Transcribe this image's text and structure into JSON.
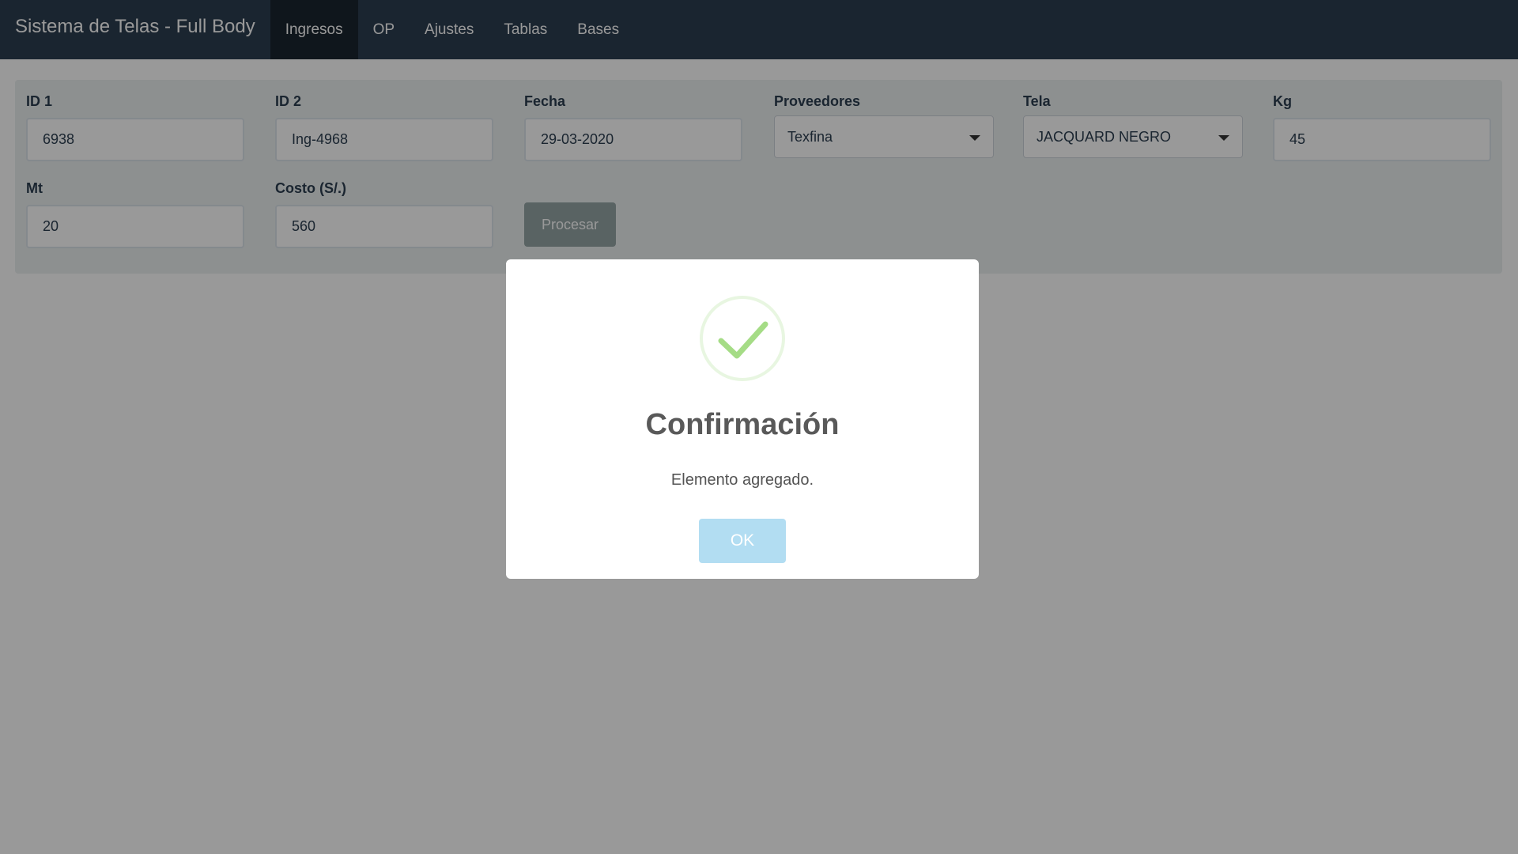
{
  "navbar": {
    "brand": "Sistema de Telas - Full Body",
    "items": [
      {
        "label": "Ingresos",
        "active": true
      },
      {
        "label": "OP",
        "active": false
      },
      {
        "label": "Ajustes",
        "active": false
      },
      {
        "label": "Tablas",
        "active": false
      },
      {
        "label": "Bases",
        "active": false
      }
    ]
  },
  "form": {
    "id1": {
      "label": "ID 1",
      "value": "6938"
    },
    "id2": {
      "label": "ID 2",
      "value": "Ing-4968"
    },
    "fecha": {
      "label": "Fecha",
      "value": "29-03-2020"
    },
    "proveedores": {
      "label": "Proveedores",
      "value": "Texfina"
    },
    "tela": {
      "label": "Tela",
      "value": "JACQUARD NEGRO"
    },
    "kg": {
      "label": "Kg",
      "value": "45"
    },
    "mt": {
      "label": "Mt",
      "value": "20"
    },
    "costo": {
      "label": "Costo (S/.)",
      "value": "560"
    },
    "procesar_label": "Procesar"
  },
  "modal": {
    "title": "Confirmación",
    "text": "Elemento agregado.",
    "ok_label": "OK"
  },
  "colors": {
    "navbar": "#2c3e50",
    "panel": "#ecf0f1",
    "success": "#a5dc86",
    "confirm_button": "#b2ddf2"
  }
}
